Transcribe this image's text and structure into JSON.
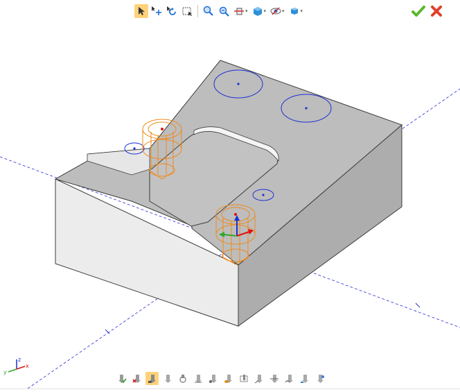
{
  "toolbar": {
    "tools": [
      {
        "icon": "select-arrow-icon",
        "active": true
      },
      {
        "icon": "move-icon",
        "active": false
      },
      {
        "icon": "rotate-icon",
        "active": false
      },
      {
        "icon": "box-select-icon",
        "active": false
      },
      {
        "icon": "zoom-in-icon",
        "active": false
      },
      {
        "icon": "zoom-fit-icon",
        "active": false
      },
      {
        "icon": "section-view-icon",
        "active": false
      },
      {
        "icon": "display-mode-icon",
        "active": false
      },
      {
        "icon": "visibility-icon",
        "active": false
      },
      {
        "icon": "shading-icon",
        "active": false
      }
    ]
  },
  "actions": {
    "confirm_icon": "checkmark-icon",
    "cancel_icon": "cancel-x-icon",
    "confirm_color": "#5cb82e",
    "cancel_color": "#e0402a"
  },
  "viewport": {
    "part_color": "#bdbdbd",
    "hole_circle_color": "#1a2fd6",
    "tool_color": "#f08a1a",
    "axis_line_color": "#2b2bdc",
    "triad_labels": {
      "x": "x",
      "y": "y",
      "z": "z"
    }
  },
  "bottom_toolbar": {
    "tools": [
      {
        "icon": "accept-feature-icon",
        "active": false
      },
      {
        "icon": "delete-feature-icon",
        "active": false
      },
      {
        "icon": "drill-feature-icon",
        "active": true
      },
      {
        "icon": "tool-feature-icon-1",
        "active": false
      },
      {
        "icon": "tool-feature-icon-2",
        "active": false
      },
      {
        "icon": "tool-feature-icon-3",
        "active": false
      },
      {
        "icon": "tool-feature-icon-4",
        "active": false
      },
      {
        "icon": "tool-feature-icon-5",
        "active": false
      },
      {
        "icon": "tool-feature-icon-6",
        "active": false
      },
      {
        "icon": "tool-feature-icon-7",
        "active": false
      },
      {
        "icon": "tool-feature-icon-8",
        "active": false
      },
      {
        "icon": "tool-feature-icon-9",
        "active": false
      },
      {
        "icon": "tool-feature-icon-10",
        "active": false
      },
      {
        "icon": "tool-feature-icon-11",
        "active": false
      }
    ]
  }
}
